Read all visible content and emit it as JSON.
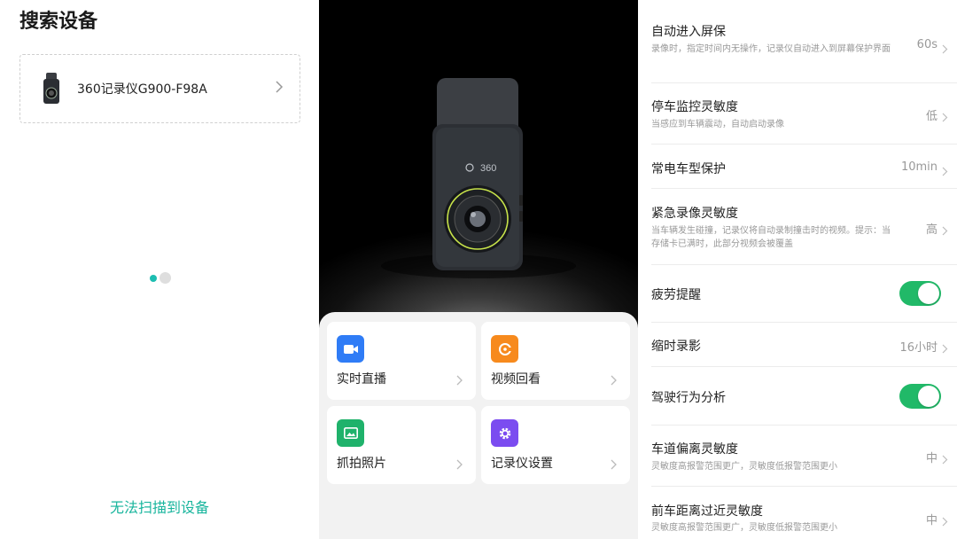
{
  "search": {
    "title": "搜索设备",
    "device_name": "360记录仪G900-F98A",
    "no_device_link": "无法扫描到设备"
  },
  "home": {
    "logo_text": "360",
    "tiles": [
      {
        "label": "实时直播",
        "icon": "video-camera-icon",
        "color": "#2f7cf6"
      },
      {
        "label": "视频回看",
        "icon": "playback-icon",
        "color": "#f78a1d"
      },
      {
        "label": "抓拍照片",
        "icon": "photo-icon",
        "color": "#1fb26b"
      },
      {
        "label": "记录仪设置",
        "icon": "gear-icon",
        "color": "#7b4cf0"
      }
    ]
  },
  "settings": {
    "rows": [
      {
        "title": "自动进入屏保",
        "subtitle": "录像时，指定时间内无操作，记录仪自动进入到屏幕保护界面",
        "value": "60s"
      },
      {
        "title": "停车监控灵敏度",
        "subtitle": "当感应到车辆震动，自动启动录像",
        "value": "低"
      },
      {
        "title": "常电车型保护",
        "subtitle": "",
        "value": "10min"
      },
      {
        "title": "紧急录像灵敏度",
        "subtitle": "当车辆发生碰撞，记录仪将自动录制撞击时的视频。提示：当存储卡已满时，此部分视频会被覆盖",
        "value": "高"
      },
      {
        "title": "疲劳提醒",
        "toggle": true,
        "on": true
      },
      {
        "title": "缩时录影",
        "subtitle": "",
        "value": "16小时"
      },
      {
        "title": "驾驶行为分析",
        "toggle": true,
        "on": true
      },
      {
        "title": "车道偏离灵敏度",
        "subtitle": "灵敏度高报警范围更广，灵敏度低报警范围更小",
        "value": "中"
      },
      {
        "title": "前车距离过近灵敏度",
        "subtitle": "灵敏度高报警范围更广，灵敏度低报警范围更小",
        "value": "中"
      }
    ]
  }
}
